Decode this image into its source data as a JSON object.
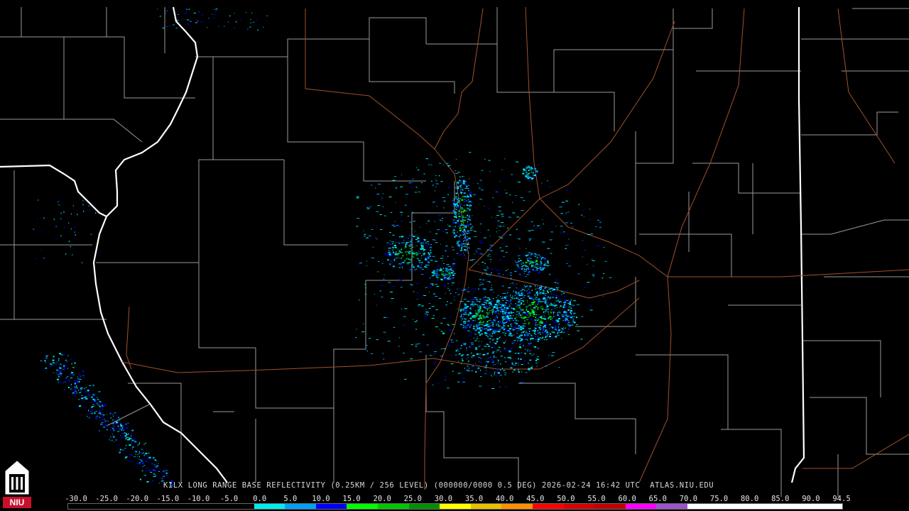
{
  "caption": "KILX LONG RANGE BASE REFLECTIVITY (0.25KM / 256 LEVEL) (000000/0000 0.5 DEG) 2026-02-24 16:42 UTC  ATLAS.NIU.EDU",
  "logo": {
    "text": "NIU",
    "colors": {
      "red": "#c8102e",
      "white": "#ffffff",
      "black": "#000000"
    }
  },
  "scale": {
    "labels": [
      "-30.0",
      "-25.0",
      "-20.0",
      "-15.0",
      "-10.0",
      "-5.0",
      "0.0",
      "5.0",
      "10.0",
      "15.0",
      "20.0",
      "25.0",
      "30.0",
      "35.0",
      "40.0",
      "45.0",
      "50.0",
      "55.0",
      "60.0",
      "65.0",
      "70.0",
      "75.0",
      "80.0",
      "85.0",
      "90.0",
      "94.5"
    ],
    "colors": [
      "#000000",
      "#000000",
      "#000000",
      "#000000",
      "#000000",
      "#000000",
      "#00ecec",
      "#01a0f6",
      "#0000f6",
      "#00ff00",
      "#00c800",
      "#009000",
      "#ffff00",
      "#e7c000",
      "#ff9000",
      "#ff0000",
      "#d60000",
      "#c00000",
      "#ff00ff",
      "#9955c9",
      "#ffffff",
      "#ffffff",
      "#ffffff",
      "#ffffff",
      "#ffffff"
    ]
  },
  "map_colors": {
    "county": "#9a9a9a",
    "state": "#ffffff",
    "road": "#a0522d",
    "background": "#000000"
  }
}
